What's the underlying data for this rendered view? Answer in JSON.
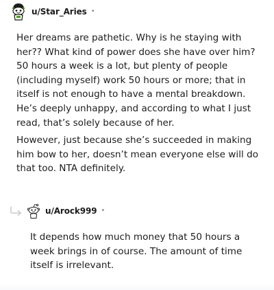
{
  "comments": [
    {
      "username": "u/Star_Aries",
      "separator": "•",
      "avatar_icon": "snoo-avatar-icon",
      "paragraphs": [
        "Her dreams are pathetic. Why is he staying with her?? What kind of power does she have over him? 50 hours a week is a lot, but plenty of people (including myself) work 50 hours or more; that in itself is not enough to have a mental breakdown. He’s deeply unhappy, and according to what I just read, that’s solely because of her.",
        "However, just because she’s succeeded in making him bow to her, doesn’t mean everyone else will do that too. NTA definitely."
      ]
    },
    {
      "username": "u/Arock999",
      "separator": "•",
      "avatar_icon": "default-snoo-avatar-icon",
      "reply_icon": "reply-arrow-icon",
      "paragraphs": [
        "It depends how much money that 50 hours a week brings in of course. The amount of time itself is irrelevant."
      ]
    }
  ],
  "colors": {
    "text": "#1c1c1c",
    "meta": "#878a8c",
    "avatar_outline": "#1c1c1c",
    "avatar_accent": "#46a508"
  }
}
